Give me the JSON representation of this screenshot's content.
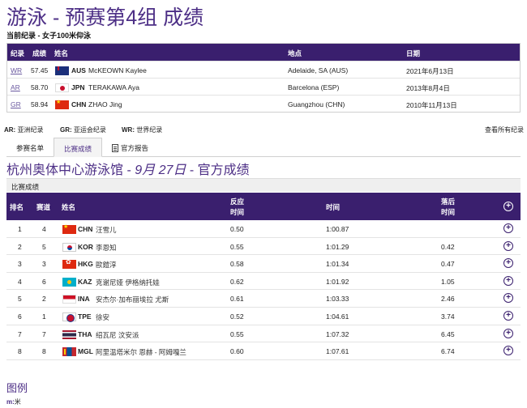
{
  "page": {
    "title": "游泳 - 预赛第4组 成绩",
    "subtitle": "当前纪录 - 女子100米仰泳"
  },
  "records": {
    "headers": {
      "record": "纪录",
      "score": "成绩",
      "name": "姓名",
      "place": "地点",
      "date": "日期"
    },
    "rows": [
      {
        "abbr": "WR",
        "score": "57.45",
        "noc": "AUS",
        "name": "McKEOWN Kaylee",
        "place": "Adelaide, SA (AUS)",
        "date": "2021年6月13日",
        "flag": "aus-flag-icon"
      },
      {
        "abbr": "AR",
        "score": "58.70",
        "noc": "JPN",
        "name": "TERAKAWA Aya",
        "place": "Barcelona (ESP)",
        "date": "2013年8月4日",
        "flag": "jpn-flag-icon"
      },
      {
        "abbr": "GR",
        "score": "58.94",
        "noc": "CHN",
        "name": "ZHAO Jing",
        "place": "Guangzhou (CHN)",
        "date": "2010年11月13日",
        "flag": "chn-flag-icon"
      }
    ]
  },
  "record_legend": [
    {
      "abbr": "AR:",
      "text": "亚洲纪录"
    },
    {
      "abbr": "GR:",
      "text": "亚运会纪录"
    },
    {
      "abbr": "WR:",
      "text": "世界纪录"
    }
  ],
  "view_all_label": "查看所有纪录",
  "tabs": [
    {
      "label": "参赛名单",
      "active": false
    },
    {
      "label": "比赛成绩",
      "active": true
    },
    {
      "label": "官方报告",
      "active": false,
      "icon": "document-icon"
    }
  ],
  "venue": {
    "name": "杭州奥体中心游泳馆",
    "sep1": " - ",
    "date": "9月 27日",
    "sep2": " - ",
    "status": "官方成绩"
  },
  "section_label": "比赛成绩",
  "results": {
    "headers": {
      "rank": "排名",
      "lane": "赛道",
      "name": "姓名",
      "reaction_line1": "反应",
      "reaction_line2": "时间",
      "time": "时间",
      "behind_line1": "落后",
      "behind_line2": "时间"
    },
    "rows": [
      {
        "rank": "1",
        "lane": "4",
        "noc": "CHN",
        "name": "汪雪儿",
        "reaction": "0.50",
        "time": "1:00.87",
        "behind": "",
        "flag": "chn"
      },
      {
        "rank": "2",
        "lane": "5",
        "noc": "KOR",
        "name": "李恩知",
        "reaction": "0.55",
        "time": "1:01.29",
        "behind": "0.42",
        "flag": "kor"
      },
      {
        "rank": "3",
        "lane": "3",
        "noc": "HKG",
        "name": "歐鎧淳",
        "reaction": "0.58",
        "time": "1:01.34",
        "behind": "0.47",
        "flag": "hkg"
      },
      {
        "rank": "4",
        "lane": "6",
        "noc": "KAZ",
        "name": "克谢尼娅 伊格纳托娃",
        "reaction": "0.62",
        "time": "1:01.92",
        "behind": "1.05",
        "flag": "kaz"
      },
      {
        "rank": "5",
        "lane": "2",
        "noc": "INA",
        "name": "安杰尔·加布丽埃拉 尤斯",
        "reaction": "0.61",
        "time": "1:03.33",
        "behind": "2.46",
        "flag": "ina"
      },
      {
        "rank": "6",
        "lane": "1",
        "noc": "TPE",
        "name": "徐安",
        "reaction": "0.52",
        "time": "1:04.61",
        "behind": "3.74",
        "flag": "tpe"
      },
      {
        "rank": "7",
        "lane": "7",
        "noc": "THA",
        "name": "绍瓦尼 汶安派",
        "reaction": "0.55",
        "time": "1:07.32",
        "behind": "6.45",
        "flag": "tha"
      },
      {
        "rank": "8",
        "lane": "8",
        "noc": "MGL",
        "name": "阿里温塔米尔 恩赫 - 阿姆嘎兰",
        "reaction": "0.60",
        "time": "1:07.61",
        "behind": "6.74",
        "flag": "mgl"
      }
    ]
  },
  "legend": {
    "title": "图例",
    "items": [
      {
        "abbr": "m:",
        "text": "米"
      }
    ]
  },
  "colors": {
    "accent": "#4d2f86",
    "header_bg": "#3a1f6e"
  }
}
